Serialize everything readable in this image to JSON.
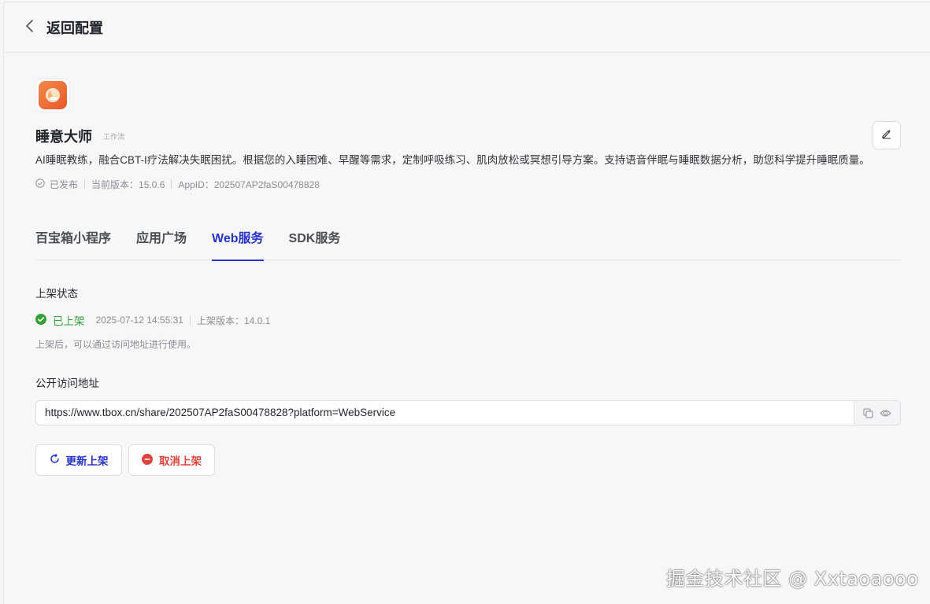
{
  "header": {
    "back_label": "返回配置"
  },
  "app": {
    "name": "睡意大师",
    "type_tag": "工作流",
    "description": "AI睡眠教练，融合CBT-I疗法解决失眠困扰。根据您的入睡困难、早醒等需求，定制呼吸练习、肌肉放松或冥想引导方案。支持语音伴眠与睡眠数据分析，助您科学提升睡眠质量。",
    "status": "已发布",
    "version": "当前版本：15.0.6",
    "app_id": "AppID：202507AP2faS00478828"
  },
  "tabs": [
    {
      "label": "百宝箱小程序"
    },
    {
      "label": "应用广场"
    },
    {
      "label": "Web服务"
    },
    {
      "label": "SDK服务"
    }
  ],
  "active_tab": "Web服务",
  "listing": {
    "section_label": "上架状态",
    "status": "已上架",
    "time": "2025-07-12 14:55:31",
    "version": "上架版本：14.0.1",
    "hint": "上架后，可以通过访问地址进行使用。"
  },
  "access": {
    "section_label": "公开访问地址",
    "url": "https://www.tbox.cn/share/202507AP2faS00478828?platform=WebService"
  },
  "actions": {
    "update_label": "更新上架",
    "cancel_label": "取消上架"
  },
  "watermark": "掘金技术社区 @ Xxtaoaooo",
  "colors": {
    "accent": "#2734c7",
    "success": "#35a03a",
    "danger": "#e0443e",
    "app_icon": "#ec6a34"
  },
  "icons": {
    "back": "chevron-left-icon",
    "edit": "pencil-icon",
    "published": "check-circle-outline-icon",
    "listed": "check-circle-filled-icon",
    "copy": "copy-icon",
    "preview": "eye-icon",
    "update": "refresh-icon",
    "cancel": "minus-circle-icon"
  }
}
